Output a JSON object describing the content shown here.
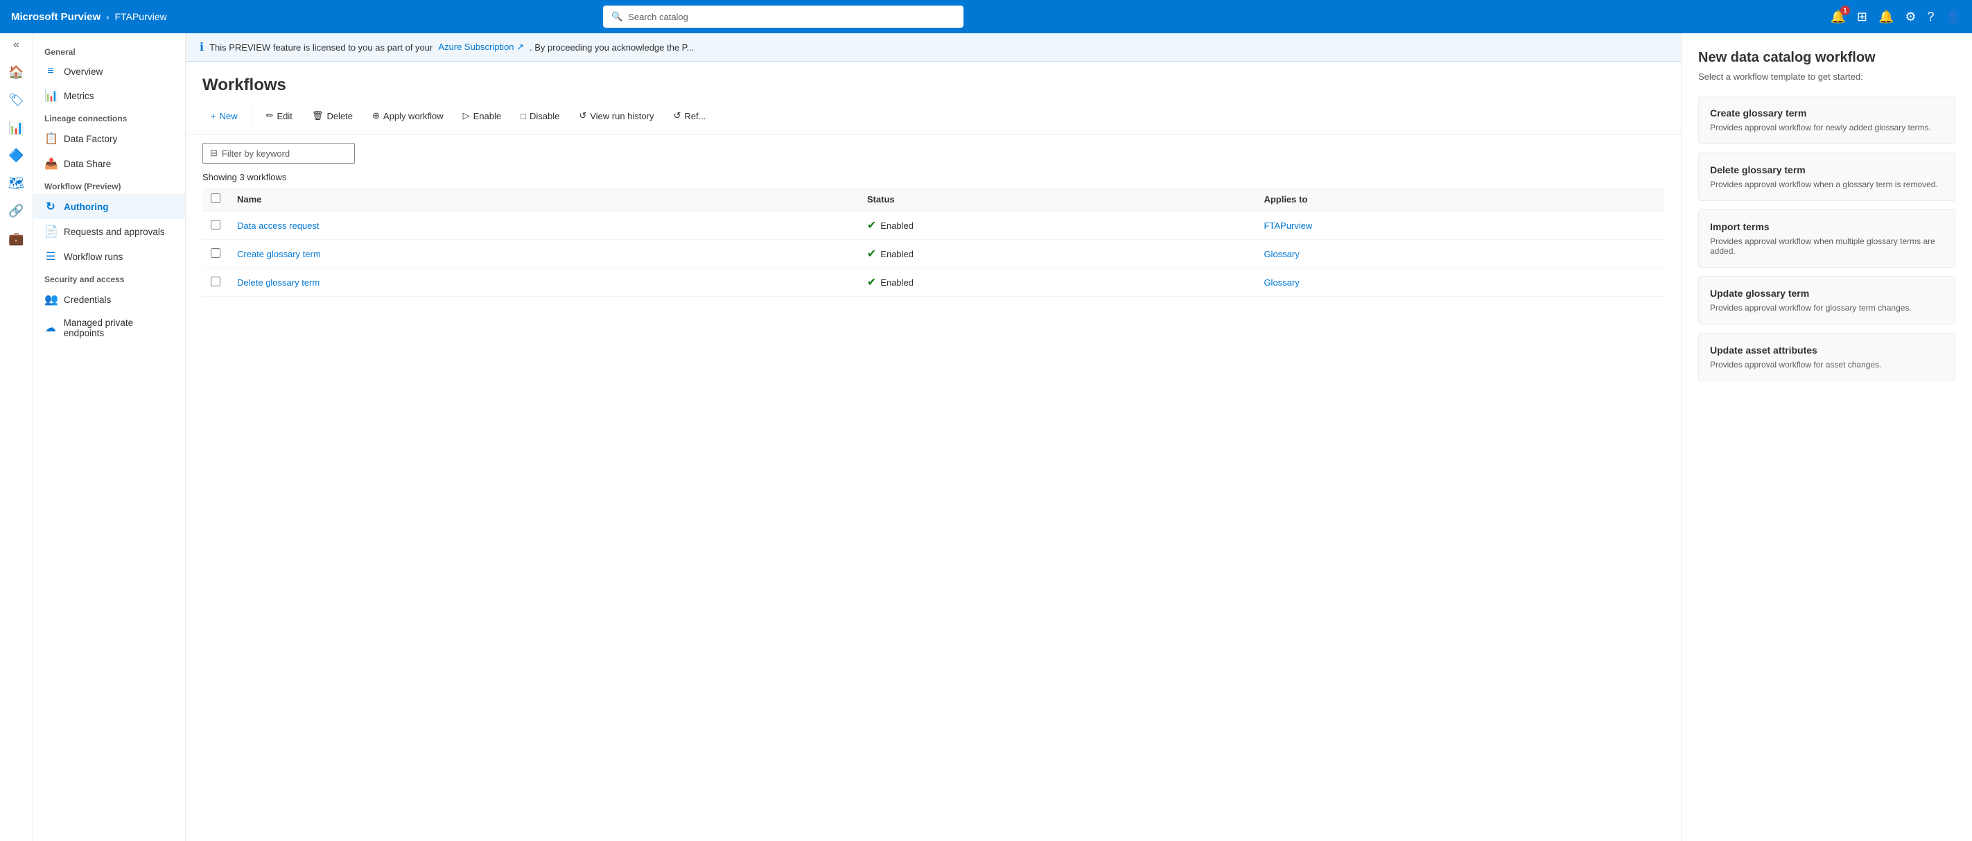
{
  "topbar": {
    "brand": "Microsoft Purview",
    "separator": "›",
    "instance": "FTAPurview",
    "search_placeholder": "Search catalog",
    "notification_count": "1"
  },
  "sidebar": {
    "general_label": "General",
    "lineage_label": "Lineage connections",
    "workflow_label": "Workflow (Preview)",
    "security_label": "Security and access",
    "items": [
      {
        "id": "overview",
        "label": "Overview",
        "icon": "≡"
      },
      {
        "id": "metrics",
        "label": "Metrics",
        "icon": "📊"
      },
      {
        "id": "data-factory",
        "label": "Data Factory",
        "icon": "📋"
      },
      {
        "id": "data-share",
        "label": "Data Share",
        "icon": "📤"
      },
      {
        "id": "authoring",
        "label": "Authoring",
        "icon": "↻"
      },
      {
        "id": "requests-approvals",
        "label": "Requests and approvals",
        "icon": "📄"
      },
      {
        "id": "workflow-runs",
        "label": "Workflow runs",
        "icon": "☰"
      },
      {
        "id": "credentials",
        "label": "Credentials",
        "icon": "👥"
      },
      {
        "id": "managed-private-endpoints",
        "label": "Managed private endpoints",
        "icon": "☁"
      }
    ]
  },
  "preview_banner": {
    "text": "This PREVIEW feature is licensed to you as part of your",
    "link_text": "Azure Subscription",
    "text2": ". By proceeding you acknowledge the P..."
  },
  "workflows": {
    "title": "Workflows",
    "toolbar": {
      "new": "New",
      "edit": "Edit",
      "delete": "Delete",
      "apply_workflow": "Apply workflow",
      "enable": "Enable",
      "disable": "Disable",
      "view_run_history": "View run history",
      "refresh": "Ref..."
    },
    "filter_placeholder": "Filter by keyword",
    "showing_text": "Showing 3 workflows",
    "columns": {
      "name": "Name",
      "status": "Status",
      "applies_to": "Applies to"
    },
    "rows": [
      {
        "name": "Data access request",
        "status": "Enabled",
        "applies_to": "FTAPurview"
      },
      {
        "name": "Create glossary term",
        "status": "Enabled",
        "applies_to": "Glossary"
      },
      {
        "name": "Delete glossary term",
        "status": "Enabled",
        "applies_to": "Glossary"
      }
    ]
  },
  "right_panel": {
    "title": "New data catalog workflow",
    "subtitle": "Select a workflow template to get started:",
    "templates": [
      {
        "id": "create-glossary-term",
        "title": "Create glossary term",
        "description": "Provides approval workflow for newly added glossary terms."
      },
      {
        "id": "delete-glossary-term",
        "title": "Delete glossary term",
        "description": "Provides approval workflow when a glossary term is removed."
      },
      {
        "id": "import-terms",
        "title": "Import terms",
        "description": "Provides approval workflow when multiple glossary terms are added."
      },
      {
        "id": "update-glossary-term",
        "title": "Update glossary term",
        "description": "Provides approval workflow for glossary term changes."
      },
      {
        "id": "update-asset-attributes",
        "title": "Update asset attributes",
        "description": "Provides approval workflow for asset changes."
      }
    ]
  }
}
